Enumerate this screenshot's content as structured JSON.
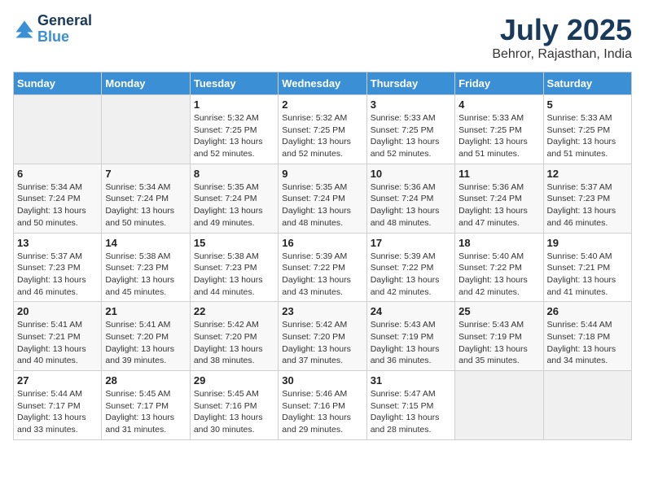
{
  "header": {
    "logo": {
      "line1": "General",
      "line2": "Blue"
    },
    "title": "July 2025",
    "location": "Behror, Rajasthan, India"
  },
  "days_of_week": [
    "Sunday",
    "Monday",
    "Tuesday",
    "Wednesday",
    "Thursday",
    "Friday",
    "Saturday"
  ],
  "weeks": [
    [
      {
        "day": "",
        "info": ""
      },
      {
        "day": "",
        "info": ""
      },
      {
        "day": "1",
        "sunrise": "5:32 AM",
        "sunset": "7:25 PM",
        "daylight": "13 hours and 52 minutes."
      },
      {
        "day": "2",
        "sunrise": "5:32 AM",
        "sunset": "7:25 PM",
        "daylight": "13 hours and 52 minutes."
      },
      {
        "day": "3",
        "sunrise": "5:33 AM",
        "sunset": "7:25 PM",
        "daylight": "13 hours and 52 minutes."
      },
      {
        "day": "4",
        "sunrise": "5:33 AM",
        "sunset": "7:25 PM",
        "daylight": "13 hours and 51 minutes."
      },
      {
        "day": "5",
        "sunrise": "5:33 AM",
        "sunset": "7:25 PM",
        "daylight": "13 hours and 51 minutes."
      }
    ],
    [
      {
        "day": "6",
        "sunrise": "5:34 AM",
        "sunset": "7:24 PM",
        "daylight": "13 hours and 50 minutes."
      },
      {
        "day": "7",
        "sunrise": "5:34 AM",
        "sunset": "7:24 PM",
        "daylight": "13 hours and 50 minutes."
      },
      {
        "day": "8",
        "sunrise": "5:35 AM",
        "sunset": "7:24 PM",
        "daylight": "13 hours and 49 minutes."
      },
      {
        "day": "9",
        "sunrise": "5:35 AM",
        "sunset": "7:24 PM",
        "daylight": "13 hours and 48 minutes."
      },
      {
        "day": "10",
        "sunrise": "5:36 AM",
        "sunset": "7:24 PM",
        "daylight": "13 hours and 48 minutes."
      },
      {
        "day": "11",
        "sunrise": "5:36 AM",
        "sunset": "7:24 PM",
        "daylight": "13 hours and 47 minutes."
      },
      {
        "day": "12",
        "sunrise": "5:37 AM",
        "sunset": "7:23 PM",
        "daylight": "13 hours and 46 minutes."
      }
    ],
    [
      {
        "day": "13",
        "sunrise": "5:37 AM",
        "sunset": "7:23 PM",
        "daylight": "13 hours and 46 minutes."
      },
      {
        "day": "14",
        "sunrise": "5:38 AM",
        "sunset": "7:23 PM",
        "daylight": "13 hours and 45 minutes."
      },
      {
        "day": "15",
        "sunrise": "5:38 AM",
        "sunset": "7:23 PM",
        "daylight": "13 hours and 44 minutes."
      },
      {
        "day": "16",
        "sunrise": "5:39 AM",
        "sunset": "7:22 PM",
        "daylight": "13 hours and 43 minutes."
      },
      {
        "day": "17",
        "sunrise": "5:39 AM",
        "sunset": "7:22 PM",
        "daylight": "13 hours and 42 minutes."
      },
      {
        "day": "18",
        "sunrise": "5:40 AM",
        "sunset": "7:22 PM",
        "daylight": "13 hours and 42 minutes."
      },
      {
        "day": "19",
        "sunrise": "5:40 AM",
        "sunset": "7:21 PM",
        "daylight": "13 hours and 41 minutes."
      }
    ],
    [
      {
        "day": "20",
        "sunrise": "5:41 AM",
        "sunset": "7:21 PM",
        "daylight": "13 hours and 40 minutes."
      },
      {
        "day": "21",
        "sunrise": "5:41 AM",
        "sunset": "7:20 PM",
        "daylight": "13 hours and 39 minutes."
      },
      {
        "day": "22",
        "sunrise": "5:42 AM",
        "sunset": "7:20 PM",
        "daylight": "13 hours and 38 minutes."
      },
      {
        "day": "23",
        "sunrise": "5:42 AM",
        "sunset": "7:20 PM",
        "daylight": "13 hours and 37 minutes."
      },
      {
        "day": "24",
        "sunrise": "5:43 AM",
        "sunset": "7:19 PM",
        "daylight": "13 hours and 36 minutes."
      },
      {
        "day": "25",
        "sunrise": "5:43 AM",
        "sunset": "7:19 PM",
        "daylight": "13 hours and 35 minutes."
      },
      {
        "day": "26",
        "sunrise": "5:44 AM",
        "sunset": "7:18 PM",
        "daylight": "13 hours and 34 minutes."
      }
    ],
    [
      {
        "day": "27",
        "sunrise": "5:44 AM",
        "sunset": "7:17 PM",
        "daylight": "13 hours and 33 minutes."
      },
      {
        "day": "28",
        "sunrise": "5:45 AM",
        "sunset": "7:17 PM",
        "daylight": "13 hours and 31 minutes."
      },
      {
        "day": "29",
        "sunrise": "5:45 AM",
        "sunset": "7:16 PM",
        "daylight": "13 hours and 30 minutes."
      },
      {
        "day": "30",
        "sunrise": "5:46 AM",
        "sunset": "7:16 PM",
        "daylight": "13 hours and 29 minutes."
      },
      {
        "day": "31",
        "sunrise": "5:47 AM",
        "sunset": "7:15 PM",
        "daylight": "13 hours and 28 minutes."
      },
      {
        "day": "",
        "info": ""
      },
      {
        "day": "",
        "info": ""
      }
    ]
  ],
  "labels": {
    "sunrise_prefix": "Sunrise: ",
    "sunset_prefix": "Sunset: ",
    "daylight_prefix": "Daylight: 13 hours"
  }
}
